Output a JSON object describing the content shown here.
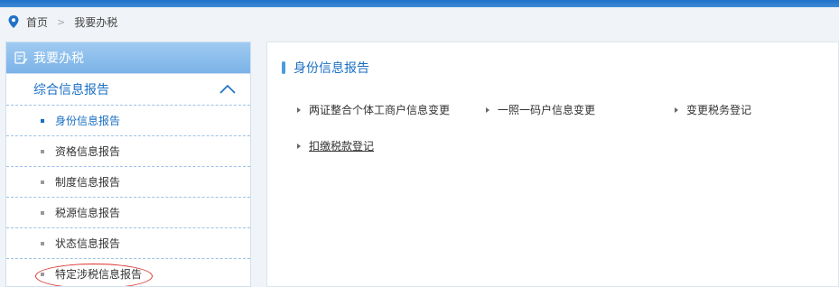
{
  "breadcrumb": {
    "home": "首页",
    "separator": ">",
    "current": "我要办税"
  },
  "sidebar": {
    "header": "我要办税",
    "group": "综合信息报告",
    "items": [
      {
        "label": "身份信息报告",
        "active": true
      },
      {
        "label": "资格信息报告",
        "active": false
      },
      {
        "label": "制度信息报告",
        "active": false
      },
      {
        "label": "税源信息报告",
        "active": false
      },
      {
        "label": "状态信息报告",
        "active": false
      },
      {
        "label": "特定涉税信息报告",
        "active": false,
        "circled": true
      }
    ]
  },
  "main": {
    "title": "身份信息报告",
    "links": [
      "两证整合个体工商户信息变更",
      "一照一码户信息变更",
      "变更税务登记",
      "扣缴税款登记"
    ]
  },
  "colors": {
    "accent": "#1a6fc3",
    "header_blue": "#7bb3e8",
    "circle_red": "#d9302b"
  }
}
